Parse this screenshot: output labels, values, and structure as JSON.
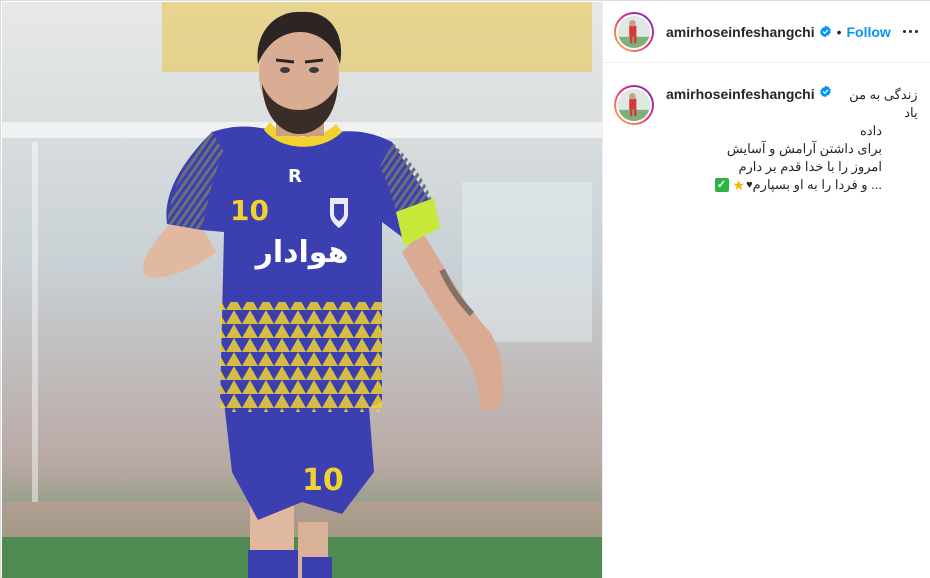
{
  "post": {
    "username": "amirhoseinfeshangchi",
    "separator": "•",
    "follow_label": "Follow",
    "more_label": "More options"
  },
  "caption": {
    "username": "amirhoseinfeshangchi",
    "lines": [
      "زندگی به من یاد",
      "داده",
      "برای داشتن آرامش و آسایش",
      "امروز را با خدا قدم بر دارم",
      "... و فردا را به او بسپارم"
    ],
    "emoji_heart": "♥",
    "emoji_star": "★",
    "emoji_check": "✓"
  },
  "photo": {
    "shirt_number": "10",
    "shorts_number": "10",
    "shirt_text": "هوادار",
    "brand_mark": "R",
    "colors": {
      "shirt": "#3b3fb0",
      "trim": "#f2d230",
      "sleeve": "#9aa0a6",
      "armband": "#c8e93a",
      "field": "#3f7d45"
    }
  },
  "icons": {
    "verified": "verified-badge-icon",
    "more": "more-options-icon"
  },
  "colors": {
    "accent": "#0095f6",
    "text": "#262626",
    "border": "#dbdbdb"
  }
}
